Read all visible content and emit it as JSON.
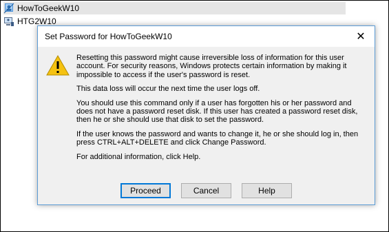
{
  "tree": {
    "items": [
      {
        "label": "HowToGeekW10",
        "selected": true,
        "icon": "user-icon"
      },
      {
        "label": "HTG2W10",
        "selected": false,
        "icon": "computer-user-icon"
      }
    ]
  },
  "dialog": {
    "title": "Set Password for HowToGeekW10",
    "close_label": "✕",
    "icon": "warning-icon",
    "paragraphs": [
      "Resetting this password might cause irreversible loss of information for this user account. For security reasons, Windows protects certain information by making it impossible to access if the user's password is reset.",
      "This data loss will occur the next time the user logs off.",
      "You should use this command only if a user has forgotten his or her password and does not have a password reset disk. If this user has created a password reset disk, then he or she should use that disk to set the password.",
      "If the user knows the password and wants to change it, he or she should log in, then press CTRL+ALT+DELETE and click Change Password.",
      "For additional information, click Help."
    ],
    "buttons": {
      "proceed": "Proceed",
      "cancel": "Cancel",
      "help": "Help"
    }
  },
  "colors": {
    "accent": "#0078d7",
    "dialog_border": "#5b9bd5",
    "warning_yellow": "#f5c211"
  }
}
